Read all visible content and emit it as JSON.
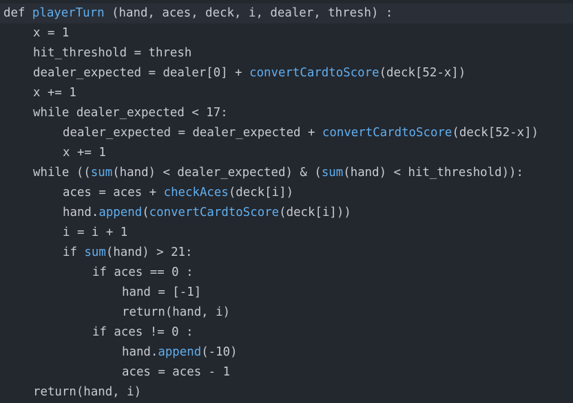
{
  "code_lines": [
    {
      "indent": 0,
      "tokens": [
        {
          "t": "def "
        },
        {
          "t": "playerTurn",
          "fn": true
        },
        {
          "t": " (hand, aces, deck, i, dealer, thresh) :"
        }
      ]
    },
    {
      "indent": 1,
      "tokens": [
        {
          "t": "x = 1"
        }
      ]
    },
    {
      "indent": 1,
      "tokens": [
        {
          "t": "hit_threshold = thresh"
        }
      ]
    },
    {
      "indent": 1,
      "tokens": [
        {
          "t": "dealer_expected = dealer[0] + "
        },
        {
          "t": "convertCardtoScore",
          "fn": true
        },
        {
          "t": "(deck[52-x])"
        }
      ]
    },
    {
      "indent": 1,
      "tokens": [
        {
          "t": "x += 1"
        }
      ]
    },
    {
      "indent": 1,
      "tokens": [
        {
          "t": "while dealer_expected < 17:"
        }
      ]
    },
    {
      "indent": 2,
      "tokens": [
        {
          "t": "dealer_expected = dealer_expected + "
        },
        {
          "t": "convertCardtoScore",
          "fn": true
        },
        {
          "t": "(deck[52-x])"
        }
      ]
    },
    {
      "indent": 2,
      "tokens": [
        {
          "t": "x += 1"
        }
      ]
    },
    {
      "indent": 1,
      "tokens": [
        {
          "t": "while (("
        },
        {
          "t": "sum",
          "fn": true
        },
        {
          "t": "(hand) < dealer_expected) & ("
        },
        {
          "t": "sum",
          "fn": true
        },
        {
          "t": "(hand) < hit_threshold)):"
        }
      ]
    },
    {
      "indent": 2,
      "tokens": [
        {
          "t": "aces = aces + "
        },
        {
          "t": "checkAces",
          "fn": true
        },
        {
          "t": "(deck[i])"
        }
      ]
    },
    {
      "indent": 2,
      "tokens": [
        {
          "t": "hand."
        },
        {
          "t": "append",
          "fn": true
        },
        {
          "t": "("
        },
        {
          "t": "convertCardtoScore",
          "fn": true
        },
        {
          "t": "(deck[i]))"
        }
      ]
    },
    {
      "indent": 2,
      "tokens": [
        {
          "t": "i = i + 1"
        }
      ]
    },
    {
      "indent": 2,
      "tokens": [
        {
          "t": "if "
        },
        {
          "t": "sum",
          "fn": true
        },
        {
          "t": "(hand) > 21:"
        }
      ]
    },
    {
      "indent": 3,
      "tokens": [
        {
          "t": "if aces == 0 :"
        }
      ]
    },
    {
      "indent": 4,
      "tokens": [
        {
          "t": "hand = [-1]"
        }
      ]
    },
    {
      "indent": 4,
      "tokens": [
        {
          "t": "return(hand, i)"
        }
      ]
    },
    {
      "indent": 3,
      "tokens": [
        {
          "t": "if aces != 0 :"
        }
      ]
    },
    {
      "indent": 4,
      "tokens": [
        {
          "t": "hand."
        },
        {
          "t": "append",
          "fn": true
        },
        {
          "t": "(-10)"
        }
      ]
    },
    {
      "indent": 4,
      "tokens": [
        {
          "t": "aces = aces - 1"
        }
      ]
    },
    {
      "indent": 1,
      "tokens": [
        {
          "t": "return(hand, i)"
        }
      ]
    }
  ],
  "colors": {
    "background": "#23272e",
    "current_line": "#2a2f37",
    "text": "#c8ccd2",
    "function": "#61afef"
  }
}
